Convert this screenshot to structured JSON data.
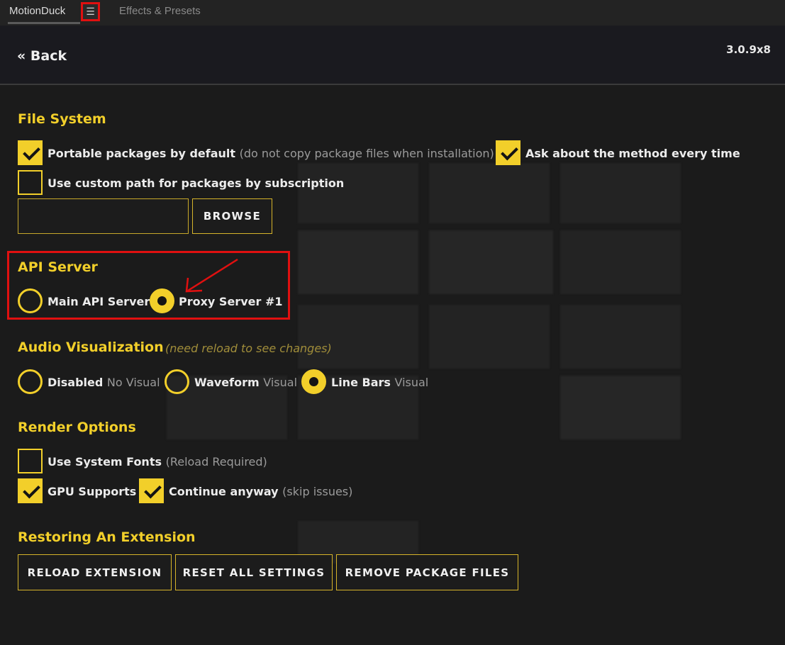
{
  "tabs": {
    "main": "MotionDuck",
    "menu_icon": "☰",
    "effects": "Effects & Presets"
  },
  "header": {
    "back": "« Back",
    "version": "3.0.9x8"
  },
  "file_system": {
    "title": "File System",
    "portable_label": "Portable packages by default",
    "portable_sub": "(do not copy package files when installation)",
    "portable_checked": true,
    "ask_label": "Ask about the method every time",
    "ask_checked": true,
    "custom_path_label": "Use custom path for packages by subscription",
    "custom_path_checked": false,
    "path_value": "",
    "browse": "BROWSE"
  },
  "api_server": {
    "title": "API Server",
    "main_label": "Main API Server",
    "proxy_label": "Proxy Server #1",
    "selected": "proxy"
  },
  "audio": {
    "title": "Audio Visualization",
    "hint": "(need reload to see changes)",
    "options": [
      {
        "label": "Disabled",
        "sub": "No Visual",
        "selected": false
      },
      {
        "label": "Waveform",
        "sub": "Visual",
        "selected": false
      },
      {
        "label": "Line Bars",
        "sub": "Visual",
        "selected": true
      }
    ]
  },
  "render": {
    "title": "Render Options",
    "system_fonts_label": "Use System Fonts",
    "system_fonts_sub": "(Reload Required)",
    "system_fonts_checked": false,
    "gpu_label": "GPU Supports",
    "gpu_checked": true,
    "continue_label": "Continue anyway",
    "continue_sub": "(skip issues)",
    "continue_checked": true
  },
  "restore": {
    "title": "Restoring An Extension",
    "reload": "RELOAD EXTENSION",
    "reset": "RESET ALL SETTINGS",
    "remove": "REMOVE PACKAGE FILES"
  },
  "colors": {
    "accent": "#f2cf2a",
    "highlight": "#e01010",
    "background": "#1b1b1b"
  },
  "icons": {
    "menu": "hamburger-icon",
    "check": "check-icon",
    "arrow": "annotation-arrow-icon"
  }
}
